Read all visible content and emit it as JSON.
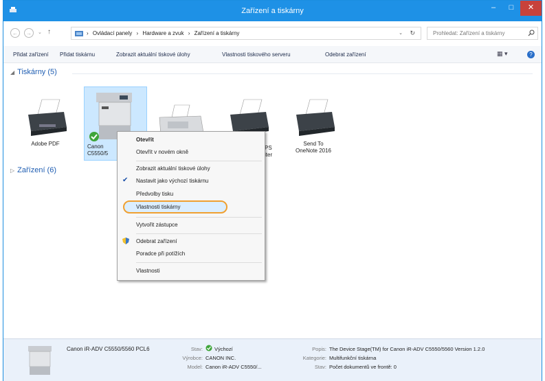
{
  "window": {
    "title": "Zařízení a tiskárny",
    "min": "–",
    "max": "□",
    "close": "✕"
  },
  "nav": {
    "back": "←",
    "forward": "→",
    "dropdown": "⌄",
    "up": "↑"
  },
  "address": {
    "crumbs": [
      "Ovládací panely",
      "Hardware a zvuk",
      "Zařízení a tiskárny"
    ],
    "separator": "›",
    "dropdown": "⌄",
    "refresh": "↻"
  },
  "search": {
    "placeholder": "Prohledat: Zařízení a tiskárny"
  },
  "toolbar": {
    "items": [
      "Přidat zařízení",
      "Přidat tiskárnu",
      "Zobrazit aktuální tiskové úlohy",
      "Vlastnosti tiskového serveru",
      "Odebrat zařízení"
    ],
    "view": "▦ ▾",
    "help": "?"
  },
  "groups": {
    "printers": {
      "label": "Tiskárny (5)",
      "arrow": "◢"
    },
    "devices": {
      "label": "Zařízení (6)",
      "arrow": "▷"
    }
  },
  "devices": [
    {
      "line1": "Adobe PDF",
      "line2": ""
    },
    {
      "line1": "Canon",
      "line2": "C5550/5"
    },
    {
      "line1": "",
      "line2": ""
    },
    {
      "line1": "PS",
      "line2": "iter"
    },
    {
      "line1": "Send To",
      "line2": "OneNote 2016"
    }
  ],
  "context_menu": {
    "items": [
      "Otevřít",
      "Otevřít v novém okně",
      "Zobrazit aktuální tiskové úlohy",
      "Nastavit jako výchozí tiskárnu",
      "Předvolby tisku",
      "Vlastnosti tiskárny",
      "Vytvořit zástupce",
      "Odebrat zařízení",
      "Poradce při potížích",
      "Vlastnosti"
    ],
    "check": "✔",
    "highlighted": "Vlastnosti tiskárny"
  },
  "details": {
    "name": "Canon iR-ADV C5550/5560 PCL6",
    "labels": {
      "status": "Stav:",
      "manufacturer": "Výrobce:",
      "model": "Model:",
      "description": "Popis:",
      "category": "Kategorie:",
      "queue": "Stav:"
    },
    "status": "Výchozí",
    "manufacturer": "CANON INC.",
    "model": "Canon iR-ADV C5550/...",
    "description": "The Device Stage(TM) for Canon iR-ADV C5550/5560 Version 1.2.0",
    "category": "Multifunkční tiskárna",
    "queue": "Počet dokumentů ve frontě: 0"
  },
  "colors": {
    "titlebar": "#1e91e6",
    "close": "#c7423b",
    "link": "#1e5db2",
    "selection": "#cce8ff",
    "highlight_ring": "#f0a030"
  }
}
